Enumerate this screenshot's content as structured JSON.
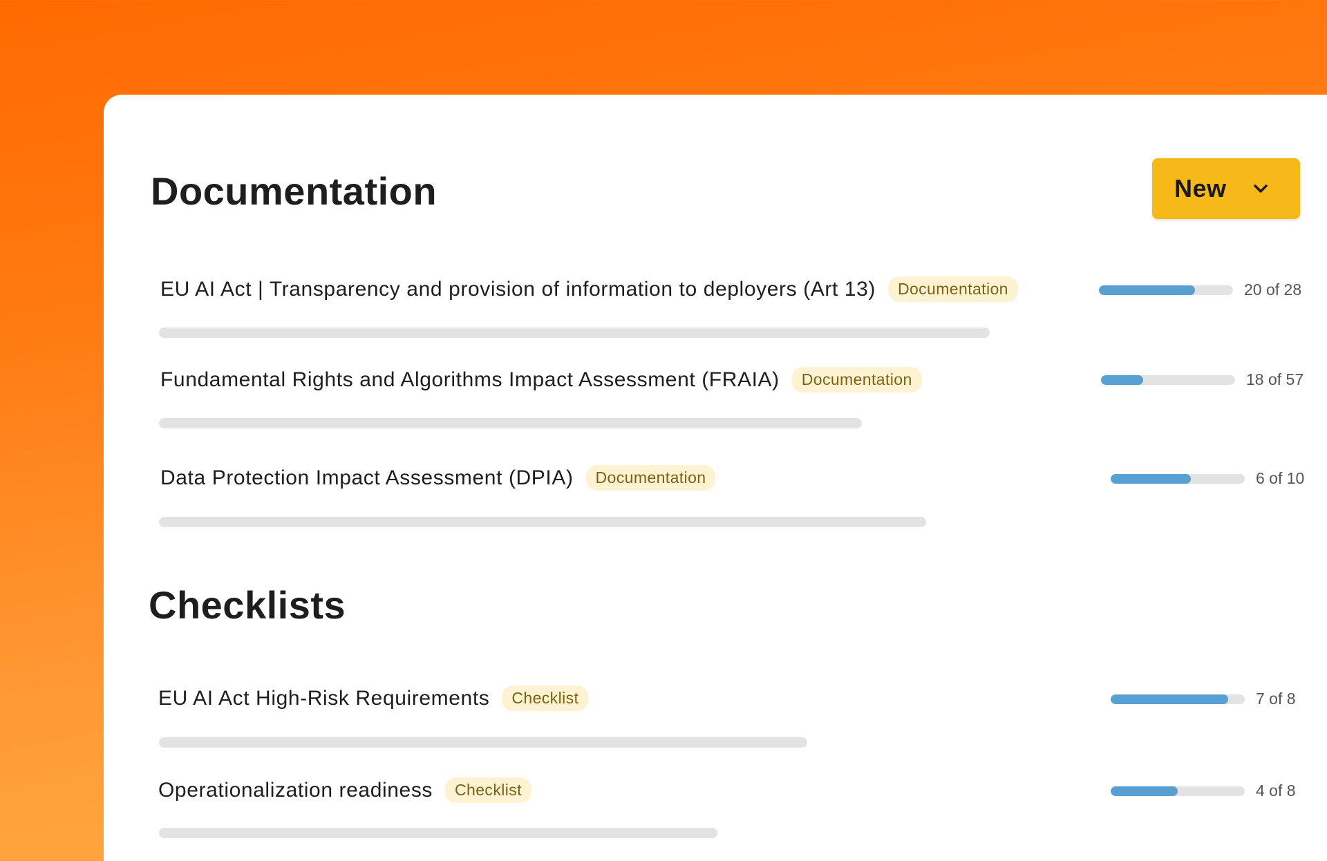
{
  "colors": {
    "accent": "#f7b919",
    "progress_fill": "#5a9fd1",
    "tag_background": "#fdf3d3",
    "tag_text": "#7b6211"
  },
  "documentation": {
    "title": "Documentation",
    "new_button": {
      "label": "New",
      "icon": "chevron-down-icon"
    },
    "items": [
      {
        "name": "EU AI Act | Transparency and provision of information to deployers (Art 13)",
        "tag": "Documentation",
        "progress_text": "20 of 28",
        "done": 20,
        "total": 28
      },
      {
        "name": "Fundamental Rights and Algorithms Impact Assessment (FRAIA)",
        "tag": "Documentation",
        "progress_text": "18 of 57",
        "done": 18,
        "total": 57
      },
      {
        "name": "Data Protection Impact Assessment (DPIA)",
        "tag": "Documentation",
        "progress_text": "6 of 10",
        "done": 6,
        "total": 10
      }
    ]
  },
  "checklists": {
    "title": "Checklists",
    "items": [
      {
        "name": "EU AI Act High-Risk Requirements",
        "tag": "Checklist",
        "progress_text": "7 of 8",
        "done": 7,
        "total": 8
      },
      {
        "name": "Operationalization readiness",
        "tag": "Checklist",
        "progress_text": "4 of 8",
        "done": 4,
        "total": 8
      }
    ]
  }
}
